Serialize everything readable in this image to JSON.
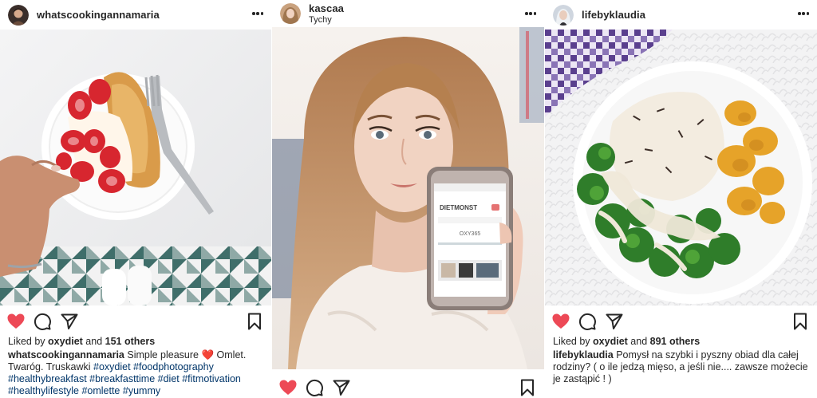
{
  "posts": [
    {
      "username": "whatscookingannamaria",
      "location": "",
      "likes": {
        "prefix": "Liked by",
        "liker": "oxydiet",
        "mid": "and",
        "others": "151 others"
      },
      "caption": {
        "text1": "Simple pleasure",
        "emoji": "❤️",
        "text2": "Omlet. Twaróg. Truskawki",
        "hashtags": [
          "#oxydiet",
          "#foodphotography",
          "#healthybreakfast",
          "#breakfasttime",
          "#diet",
          "#fitmotivation",
          "#healthylifestyle",
          "#omlette",
          "#yummy"
        ]
      },
      "liked": true
    },
    {
      "username": "kascaa",
      "location": "Tychy",
      "liked": true
    },
    {
      "username": "lifebyklaudia",
      "location": "",
      "likes": {
        "prefix": "Liked by",
        "liker": "oxydiet",
        "mid": "and",
        "others": "891 others"
      },
      "caption": {
        "text1": "Pomysł na szybki i pyszny obiad dla całej rodziny? ( o ile jedzą mięso, a jeśli nie.... zawsze możecie je zastąpić ! )"
      },
      "liked": true
    }
  ],
  "colors": {
    "like_red": "#ed4956",
    "hashtag": "#003569",
    "text": "#262626"
  },
  "phone_screen": {
    "brand": "DIETMONST",
    "title": "OXY365"
  }
}
